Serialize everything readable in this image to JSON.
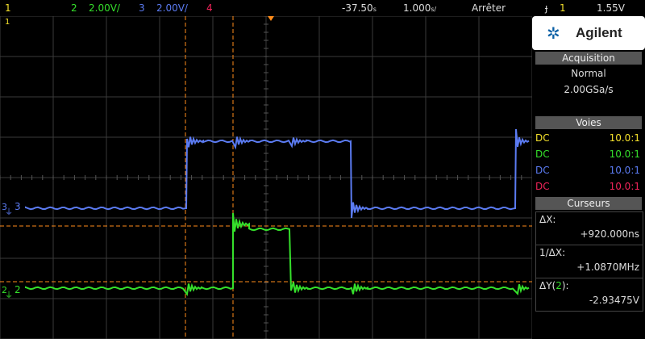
{
  "topbar": {
    "ch1": "1",
    "ch2_num": "2",
    "ch2_scale": "2.00V/",
    "ch3_num": "3",
    "ch3_scale": "2.00V/",
    "ch4": "4",
    "delay": "-37.50",
    "delay_unit": "s",
    "timebase": "1.000",
    "timebase_unit": "s/",
    "run_state": "Arrêter",
    "trig_icon": "rising-edge-icon",
    "trig_ch": "1",
    "trig_level": "1.55V"
  },
  "panel": {
    "brand": "Agilent",
    "acq_title": "Acquisition",
    "acq_mode": "Normal",
    "acq_rate": "2.00GSa/s",
    "voies_title": "Voies",
    "voies": [
      {
        "coupling": "DC",
        "probe": "10.0:1",
        "color": "#f5e12b"
      },
      {
        "coupling": "DC",
        "probe": "10.0:1",
        "color": "#35e02b"
      },
      {
        "coupling": "DC",
        "probe": "10.0:1",
        "color": "#5b7bf2"
      },
      {
        "coupling": "DC",
        "probe": "10.0:1",
        "color": "#f0245a"
      }
    ],
    "cursors_title": "Curseurs",
    "dx_label": "ΔX:",
    "dx_value": "+920.000ns",
    "inv_dx_label": "1/ΔX:",
    "inv_dx_value": "+1.0870MHz",
    "dy_label_pre": "ΔY(",
    "dy_label_ch": "2",
    "dy_label_post": "):",
    "dy_value": "-2.93475V"
  },
  "markers": {
    "ch3_label": "3",
    "ch2_label": "2",
    "ch1_edge_label": "1"
  },
  "colors": {
    "ch1": "#f5e12b",
    "ch2": "#35e02b",
    "ch3": "#5b7bf2",
    "ch4": "#f0245a",
    "cursor": "#ff8c1a",
    "grid": "#3a3a3a"
  }
}
